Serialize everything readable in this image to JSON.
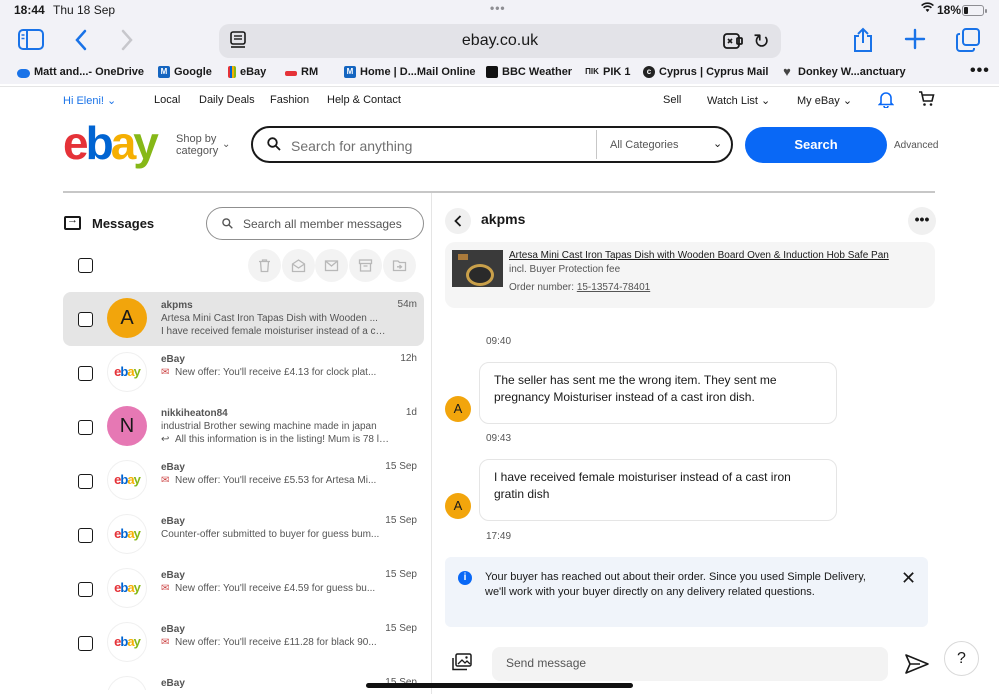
{
  "status": {
    "time": "18:44",
    "date": "Thu 18 Sep",
    "battery": "18%"
  },
  "browser": {
    "url": "ebay.co.uk"
  },
  "bookmarks": [
    {
      "label": "Matt and...- OneDrive",
      "icon": "onedrive-icon"
    },
    {
      "label": "Google",
      "icon": "google-icon"
    },
    {
      "label": "eBay",
      "icon": "ebay-icon"
    },
    {
      "label": "RM",
      "icon": "rm-icon"
    },
    {
      "label": "Home | D...Mail Online",
      "icon": "dailymail-icon"
    },
    {
      "label": "BBC Weather",
      "icon": "bbc-icon"
    },
    {
      "label": "PIK 1",
      "icon": "pik-icon"
    },
    {
      "label": "Cyprus | Cyprus Mail",
      "icon": "cyprusmail-icon"
    },
    {
      "label": "Donkey W...anctuary",
      "icon": "heart-icon"
    }
  ],
  "topnav": {
    "greeting": "Hi Eleni!",
    "local": "Local",
    "deals": "Daily Deals",
    "fashion": "Fashion",
    "help": "Help & Contact",
    "sell": "Sell",
    "watchlist": "Watch List",
    "myebay": "My eBay"
  },
  "header": {
    "shop_by_1": "Shop by",
    "shop_by_2": "category",
    "search_placeholder": "Search for anything",
    "category": "All Categories",
    "search_button": "Search",
    "advanced": "Advanced"
  },
  "messages": {
    "title": "Messages",
    "search_placeholder": "Search all member messages",
    "conversations": [
      {
        "sender": "akpms",
        "time": "54m",
        "line1": "Artesa Mini Cast Iron Tapas Dish with Wooden ...",
        "line2": "I have received female moisturiser instead of a cast iro...",
        "avatar": "A"
      },
      {
        "sender": "eBay",
        "time": "12h",
        "line1": "",
        "line2": "New offer: You'll receive £4.13 for clock plat...",
        "avatar": "ebay"
      },
      {
        "sender": "nikkiheaton84",
        "time": "1d",
        "line1": "industrial Brother sewing machine made in japan",
        "line2": "All this information is in the listing! Mum is 78 loosi...",
        "avatar": "N"
      },
      {
        "sender": "eBay",
        "time": "15 Sep",
        "line1": "",
        "line2": "New offer: You'll receive £5.53 for Artesa Mi...",
        "avatar": "ebay"
      },
      {
        "sender": "eBay",
        "time": "15 Sep",
        "line1": "",
        "line2": "Counter-offer submitted to buyer for guess bum...",
        "avatar": "ebay"
      },
      {
        "sender": "eBay",
        "time": "15 Sep",
        "line1": "",
        "line2": "New offer: You'll receive £4.59 for guess bu...",
        "avatar": "ebay"
      },
      {
        "sender": "eBay",
        "time": "15 Sep",
        "line1": "",
        "line2": "New offer: You'll receive £11.28 for black 90...",
        "avatar": "ebay"
      },
      {
        "sender": "eBay",
        "time": "15 Sep",
        "line1": "",
        "line2": "",
        "avatar": "ebay"
      }
    ]
  },
  "conversation": {
    "name": "akpms",
    "item_title": "Artesa Mini Cast Iron Tapas Dish with Wooden Board Oven & Induction Hob Safe Pan",
    "item_sub": "incl. Buyer Protection fee",
    "order_label": "Order number: ",
    "order_number": "15-13574-78401",
    "messages": [
      {
        "time": "09:40",
        "text": "The seller has sent me the wrong item. They sent me pregnancy Moisturiser instead of a cast iron dish.",
        "avatar": "A"
      },
      {
        "time": "09:43",
        "text": "I have received female moisturiser instead of a cast iron gratin dish",
        "avatar": "A"
      }
    ],
    "last_time": "17:49",
    "info": "Your buyer has reached out about their order. Since you used Simple Delivery, we'll work with your buyer directly on any delivery related questions.",
    "input_placeholder": "Send message",
    "help": "?"
  },
  "colors": {
    "ebay_blue": "#0968f6",
    "avatar_orange": "#f2a50c",
    "avatar_pink": "#e678b4"
  }
}
